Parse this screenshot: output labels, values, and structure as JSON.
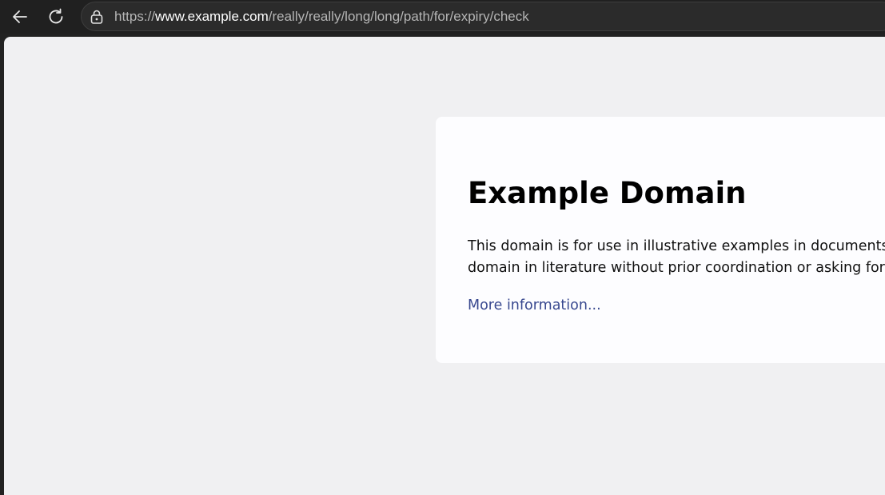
{
  "browser": {
    "back_icon": "arrow-left-icon",
    "reload_icon": "reload-icon",
    "lock_icon": "lock-icon",
    "url": {
      "scheme": "https://",
      "host": "www.example.com",
      "path": "/really/really/long/long/path/for/expiry/check"
    }
  },
  "page": {
    "title": "Example Domain",
    "description_lines": [
      "This domain is for use in illustrative examples in documents. You may use this",
      "domain in literature without prior coordination or asking for permission."
    ],
    "more_link": "More information..."
  },
  "colors": {
    "toolbar": "#202020",
    "page_background": "#f0f0f2",
    "card_background": "#fdfdff",
    "link": "#38488f"
  }
}
